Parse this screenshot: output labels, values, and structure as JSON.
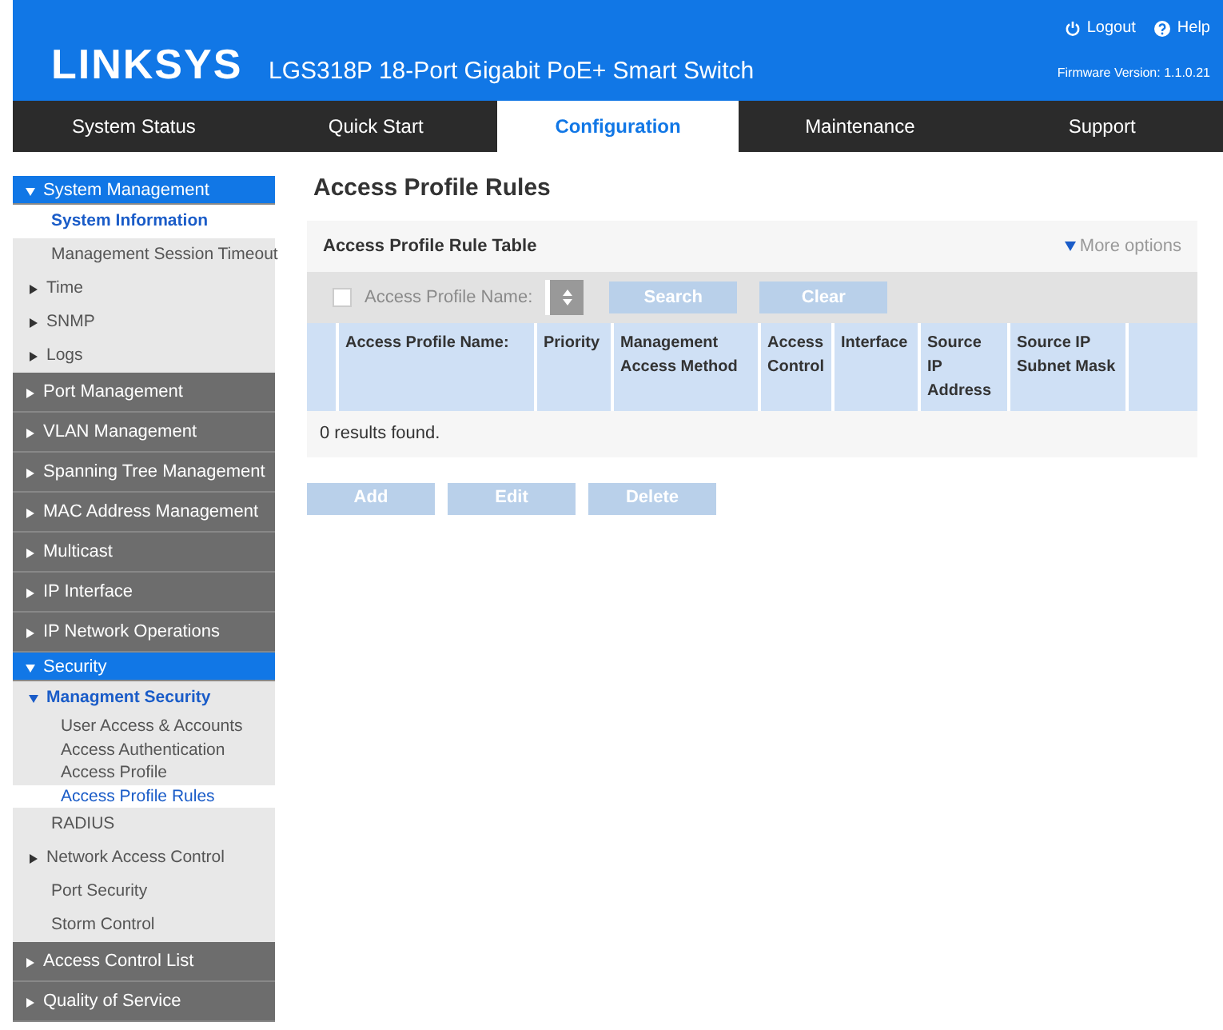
{
  "header": {
    "brand": "LINKSYS",
    "product": "LGS318P 18-Port Gigabit PoE+ Smart Switch",
    "links": [
      {
        "label": "Logout",
        "kind": "power"
      },
      {
        "label": "Help",
        "kind": "help"
      }
    ],
    "firmware": "Firmware Version: 1.1.0.21"
  },
  "tabs": [
    {
      "label": "System Status",
      "selected": false
    },
    {
      "label": "Quick Start",
      "selected": false
    },
    {
      "label": "Configuration",
      "selected": true
    },
    {
      "label": "Maintenance",
      "selected": false
    },
    {
      "label": "Support",
      "selected": false
    }
  ],
  "sidebar": [
    {
      "label": "System Management",
      "expanded": true,
      "children": [
        {
          "label": "System Information",
          "kind": "page",
          "selected": true
        },
        {
          "label": "Management Session Timeout",
          "kind": "page",
          "selected": false
        },
        {
          "label": "Time",
          "kind": "folder",
          "expanded": false,
          "selected": false
        },
        {
          "label": "SNMP",
          "kind": "folder",
          "expanded": false,
          "selected": false
        },
        {
          "label": "Logs",
          "kind": "folder",
          "expanded": false,
          "selected": false
        }
      ]
    },
    {
      "label": "Port Management",
      "expanded": false
    },
    {
      "label": "VLAN Management",
      "expanded": false
    },
    {
      "label": "Spanning Tree Management",
      "expanded": false
    },
    {
      "label": "MAC Address Management",
      "expanded": false
    },
    {
      "label": "Multicast",
      "expanded": false
    },
    {
      "label": "IP Interface",
      "expanded": false
    },
    {
      "label": "IP Network Operations",
      "expanded": false
    },
    {
      "label": "Security",
      "expanded": true,
      "children": [
        {
          "label": "Managment Security",
          "kind": "folder",
          "expanded": true,
          "selected": false,
          "children": [
            {
              "label": "User Access & Accounts",
              "selected": false
            },
            {
              "label": "Access Authentication",
              "selected": false
            },
            {
              "label": "Access Profile",
              "selected": false
            },
            {
              "label": "Access Profile Rules",
              "selected": true
            }
          ]
        },
        {
          "label": "RADIUS",
          "kind": "page",
          "selected": false
        },
        {
          "label": "Network Access Control",
          "kind": "folder",
          "expanded": false,
          "selected": false
        },
        {
          "label": "Port Security",
          "kind": "page",
          "selected": false
        },
        {
          "label": "Storm Control",
          "kind": "page",
          "selected": false
        }
      ]
    },
    {
      "label": "Access Control List",
      "expanded": false
    },
    {
      "label": "Quality of Service",
      "expanded": false
    }
  ],
  "page_title": "Access Profile Rules",
  "panel": {
    "title": "Access Profile Rule Table",
    "more_options": "More options",
    "filter": {
      "checked": false,
      "label": "Access Profile Name:",
      "disabled": true
    },
    "filter_buttons": [
      "Search",
      "Clear"
    ],
    "columns": [
      "Access Profile Name:",
      "Priority",
      "Management Access Method",
      "Access Control",
      "Interface",
      "Source IP Address",
      "Source IP Subnet Mask"
    ],
    "result_text": "0 results found."
  },
  "actions": [
    {
      "label": "Add",
      "disabled": true
    },
    {
      "label": "Edit",
      "disabled": true
    },
    {
      "label": "Delete",
      "disabled": true
    }
  ]
}
